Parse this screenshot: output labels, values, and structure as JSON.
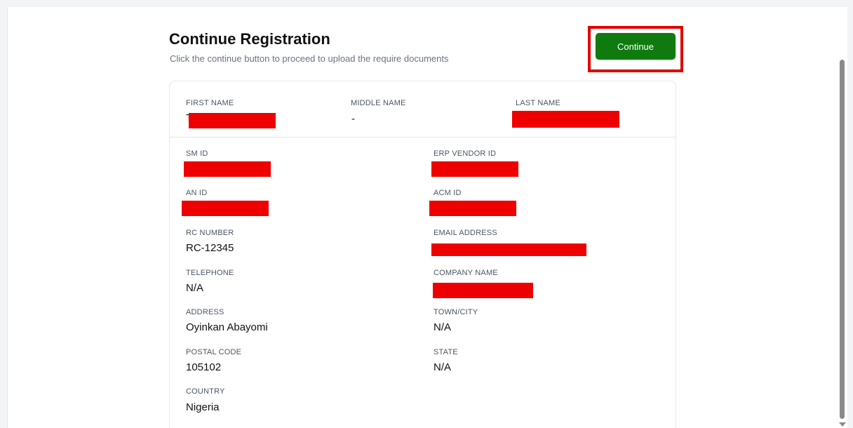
{
  "header": {
    "title": "Continue Registration",
    "subtitle": "Click the continue button to proceed to upload the require documents",
    "continue_label": "Continue"
  },
  "colors": {
    "primary_button": "#0f7b0f",
    "highlight_border": "#e00000",
    "redaction": "#ee0000"
  },
  "name_row": {
    "first_name_label": "FIRST NAME",
    "first_name_value_visible": "T",
    "middle_name_label": "MIDDLE NAME",
    "middle_name_value": "-",
    "last_name_label": "LAST NAME"
  },
  "details": {
    "sm_id_label": "SM ID",
    "erp_vendor_id_label": "ERP VENDOR ID",
    "an_id_label": "AN ID",
    "acm_id_label": "ACM ID",
    "rc_number_label": "RC NUMBER",
    "rc_number_value": "RC-12345",
    "email_label": "EMAIL ADDRESS",
    "telephone_label": "TELEPHONE",
    "telephone_value": "N/A",
    "company_name_label": "COMPANY NAME",
    "address_label": "ADDRESS",
    "address_value": "Oyinkan Abayomi",
    "town_city_label": "TOWN/CITY",
    "town_city_value": "N/A",
    "postal_code_label": "POSTAL CODE",
    "postal_code_value": "105102",
    "state_label": "STATE",
    "state_value": "N/A",
    "country_label": "COUNTRY",
    "country_value": "Nigeria"
  }
}
